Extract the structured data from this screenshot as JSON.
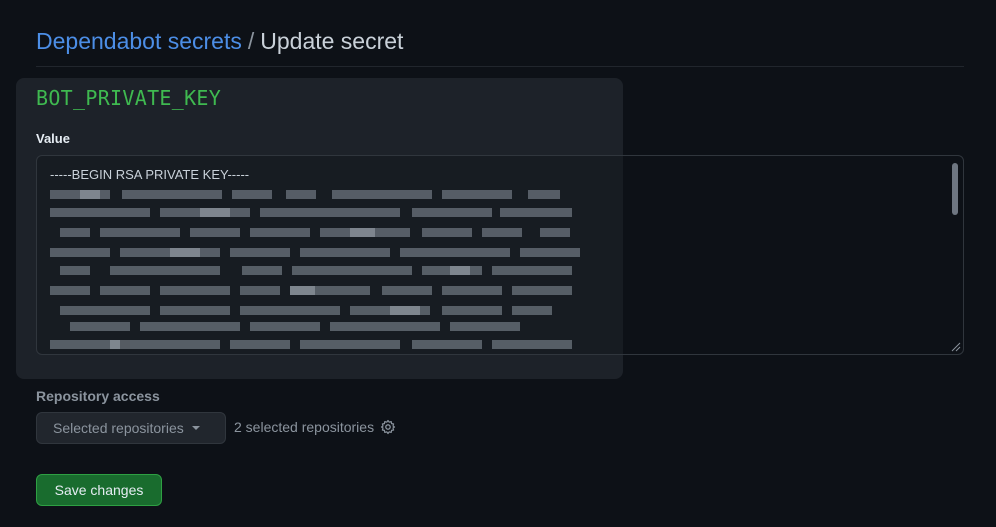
{
  "breadcrumb": {
    "parent": "Dependabot secrets",
    "separator": "/",
    "current": "Update secret"
  },
  "secret": {
    "name": "BOT_PRIVATE_KEY",
    "value_label": "Value",
    "value_first_line": "-----BEGIN RSA PRIVATE KEY-----",
    "value_obscured": true
  },
  "repository_access": {
    "label": "Repository access",
    "selected_option": "Selected repositories",
    "selected_count_text": "2 selected repositories"
  },
  "actions": {
    "save_label": "Save changes"
  },
  "colors": {
    "background": "#0d1117",
    "link": "#4c8ee6",
    "secret_name": "#3fb950",
    "save_button": "#196c2e"
  },
  "icons": [
    "chevron-down-icon",
    "gear-icon",
    "resize-handle-icon"
  ]
}
